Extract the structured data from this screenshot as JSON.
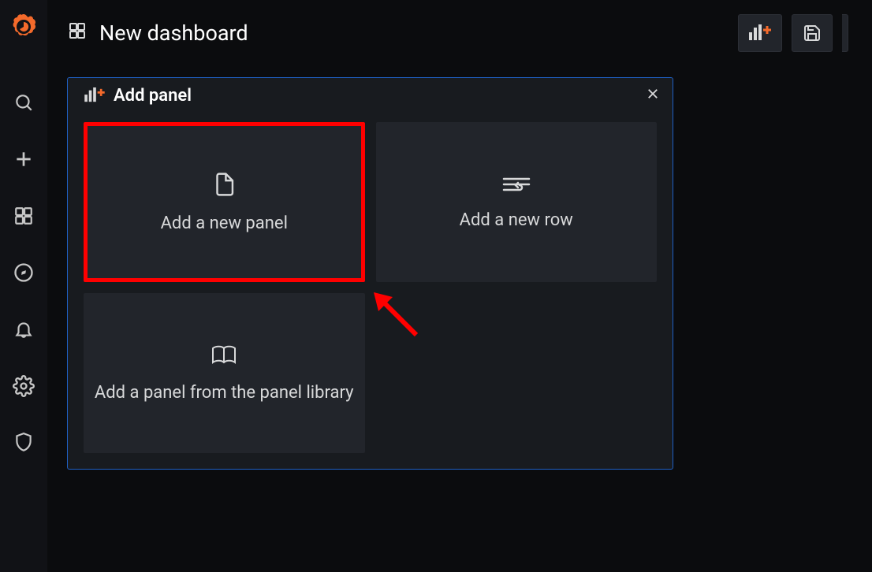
{
  "breadcrumb": {
    "title": "New dashboard"
  },
  "panel": {
    "title": "Add panel"
  },
  "cards": {
    "new_panel": "Add a new panel",
    "new_row": "Add a new row",
    "library": "Add a panel from the panel library"
  }
}
